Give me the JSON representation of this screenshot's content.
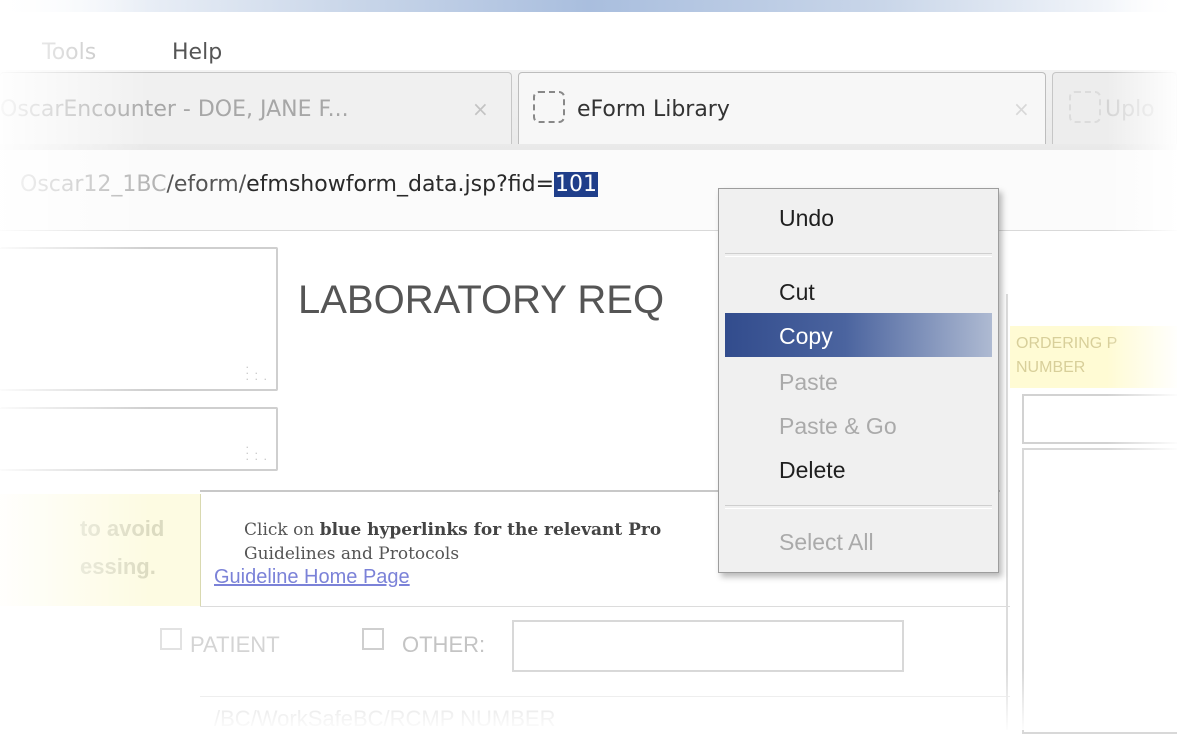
{
  "menubar": {
    "items": [
      {
        "label": "Tools"
      },
      {
        "label": "Help"
      }
    ]
  },
  "tabs": [
    {
      "label": "OscarEncounter - DOE, JANE F...",
      "close": "×"
    },
    {
      "label": "eForm Library",
      "close": "×"
    },
    {
      "label": "Uplo"
    }
  ],
  "urlbar": {
    "prefix": "Oscar12_1BC",
    "mid": "/eform/",
    "main": "efmshowform_data.jsp?fid=",
    "selected": "101"
  },
  "form": {
    "title": "LABORATORY REQ",
    "warning_line1": "to avoid",
    "warning_line2": "essing.",
    "info_prefix": "Click on ",
    "info_bold": "blue hyperlinks  for the relevant Pro",
    "info_line2": "Guidelines  and  Protocols",
    "guideline_link": "Guideline Home Page",
    "patient_label": "PATIENT",
    "other_label": "OTHER:",
    "number_label": "/BC/WorkSafeBC/RCMP NUMBER",
    "ordering_label": "ORDERING P NUMBER"
  },
  "context_menu": {
    "items": [
      {
        "label": "Undo",
        "enabled": true
      },
      {
        "label": "Cut",
        "enabled": true
      },
      {
        "label": "Copy",
        "enabled": true,
        "highlighted": true
      },
      {
        "label": "Paste",
        "enabled": false
      },
      {
        "label": "Paste & Go",
        "enabled": false
      },
      {
        "label": "Delete",
        "enabled": true
      },
      {
        "label": "Select All",
        "enabled": false
      }
    ]
  },
  "colors": {
    "selection": "#1f3e8a",
    "menu_highlight": "#324c8d",
    "link": "#7b82d8",
    "warning_bg": "#fdfbe2"
  }
}
